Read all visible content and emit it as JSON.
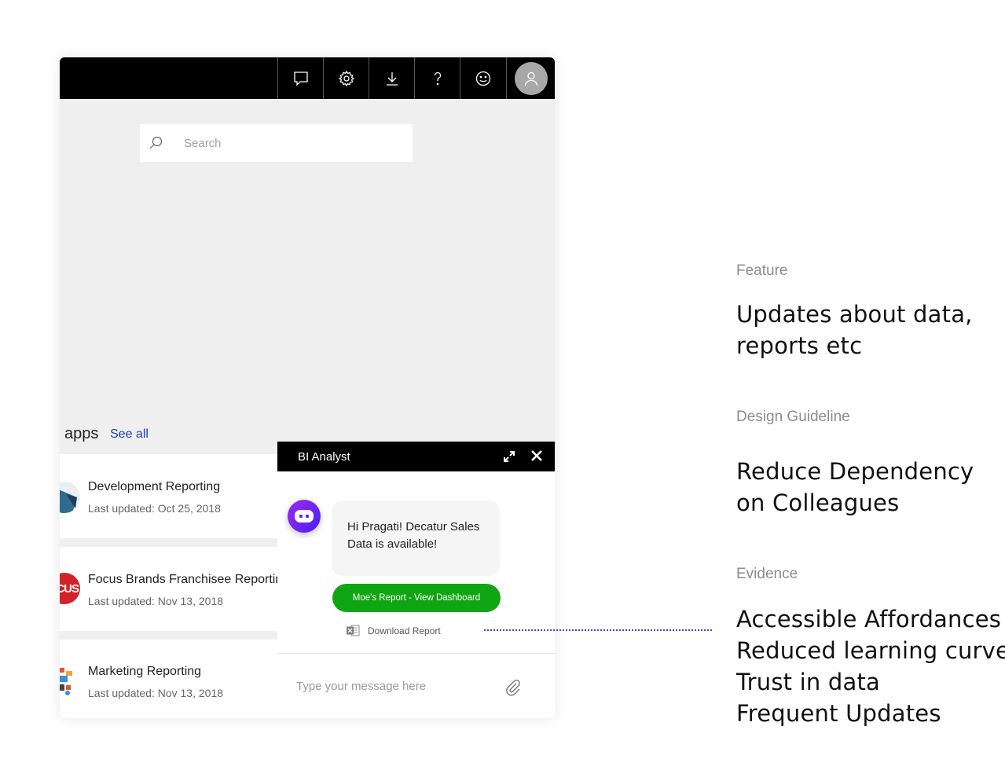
{
  "search": {
    "placeholder": "Search"
  },
  "apps_section": {
    "heading": "apps",
    "see_all": "See all"
  },
  "apps": [
    {
      "name": "Development Reporting",
      "updated": "Last updated: Oct 25, 2018"
    },
    {
      "name": "Focus Brands Franchisee Reporting",
      "updated": "Last updated: Nov 13, 2018",
      "thumb_text": "CUS"
    },
    {
      "name": "Marketing Reporting",
      "updated": "Last updated: Nov 13, 2018"
    }
  ],
  "chat": {
    "title": "BI Analyst",
    "message": "Hi Pragati! Decatur Sales Data is available!",
    "cta_label": "Moe's Report - View Dashboard",
    "download_label": "Download Report",
    "input_placeholder": "Type your message here"
  },
  "annotations": {
    "feature_label": "Feature",
    "feature_lines": [
      "Updates about data,",
      "reports etc"
    ],
    "guideline_label": "Design Guideline",
    "guideline_lines": [
      "Reduce Dependency",
      "on Colleagues"
    ],
    "evidence_label": "Evidence",
    "evidence_lines": [
      "Accessible Affordances",
      "Reduced learning curve",
      "Trust in data",
      "Frequent Updates"
    ]
  },
  "colors": {
    "topbar": "#000000",
    "cta": "#10a513",
    "bot_gradient": [
      "#9b2cf0",
      "#4a1df0"
    ],
    "connector": "#4b3ff0",
    "link": "#1a3fbf"
  },
  "icons": [
    "feedback-icon",
    "settings-icon",
    "download-icon",
    "help-icon",
    "smiley-icon",
    "user-avatar-icon",
    "search-icon",
    "expand-icon",
    "close-icon",
    "bot-icon",
    "excel-icon",
    "paperclip-icon"
  ]
}
